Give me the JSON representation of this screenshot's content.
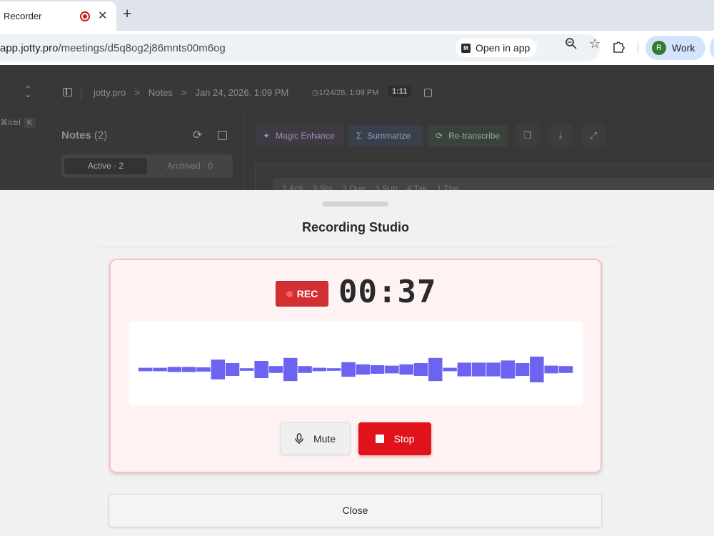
{
  "browser": {
    "tab_title": "Recorder",
    "new_tab_symbol": "+",
    "close_tab_symbol": "✕",
    "url_host": "app.jotty.pro",
    "url_path": "/meetings/d5q8og2j86mnts00m6og",
    "open_in_app_label": "Open in app",
    "open_in_app_logo": "M",
    "profile_initial": "R",
    "profile_name": "Work"
  },
  "app": {
    "shortcut_prefix": "⌘/ctrl",
    "shortcut_key": "K",
    "breadcrumb": [
      "jotty.pro",
      ">",
      "Notes",
      ">",
      "Jan 24, 2026, 1:09 PM"
    ],
    "meeting_time": "1/24/26, 1:09 PM",
    "duration": "1:11",
    "notes_title": "Notes",
    "notes_count": "(2)",
    "tabs": {
      "active": "Active · 2",
      "archived": "Archived · 0"
    },
    "actions": {
      "magic_enhance": "Magic Enhance",
      "summarize": "Summarize",
      "retranscribe": "Re-transcribe"
    },
    "content_tabs_preview": "2 Acti...   3 Sta...   3 Que...   3 Sub...   4 Tak...   1 The..."
  },
  "sheet": {
    "title": "Recording Studio",
    "rec_label": "REC",
    "timer": "00:37",
    "mute_label": "Mute",
    "stop_label": "Stop",
    "close_label": "Close"
  },
  "waveform": {
    "bar_color": "#6c63f0",
    "levels": [
      0.08,
      0.08,
      0.12,
      0.12,
      0.1,
      0.46,
      0.3,
      0.06,
      0.4,
      0.16,
      0.54,
      0.16,
      0.08,
      0.06,
      0.34,
      0.24,
      0.2,
      0.18,
      0.24,
      0.3,
      0.54,
      0.08,
      0.32,
      0.32,
      0.32,
      0.42,
      0.3,
      0.6,
      0.18,
      0.16
    ]
  },
  "colors": {
    "rec_red": "#d33034",
    "stop_red": "#e0121a",
    "profile_bg": "#d3e3fd"
  }
}
